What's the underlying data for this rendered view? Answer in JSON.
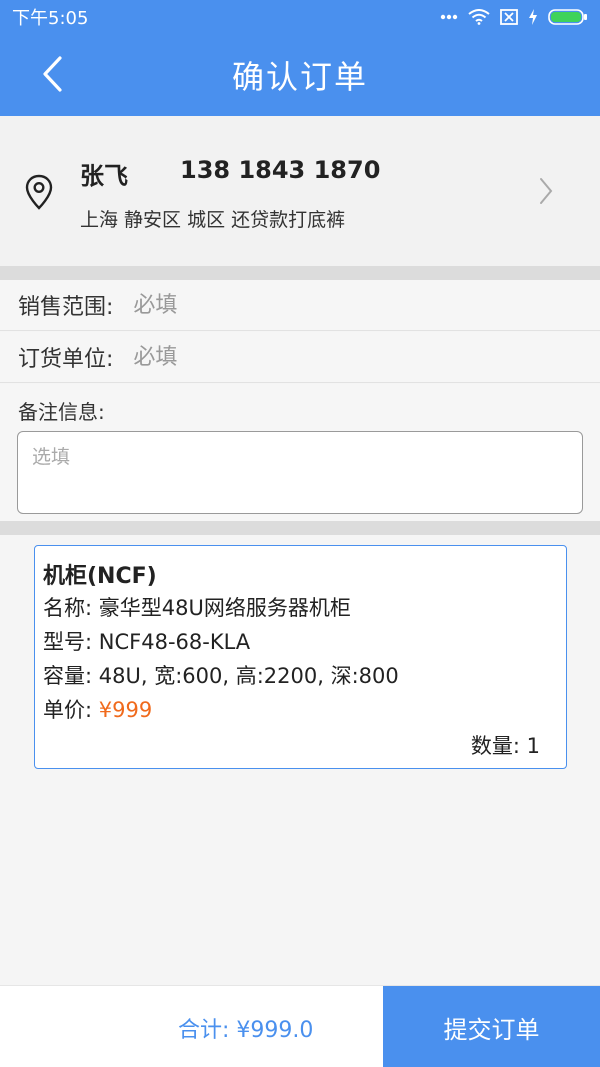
{
  "status_bar": {
    "time": "下午5:05"
  },
  "header": {
    "title": "确认订单",
    "back_icon": "chevron-left-icon"
  },
  "address": {
    "name": "张飞",
    "phone": "138 1843 1870",
    "line": "上海 静安区 城区 还贷款打底裤"
  },
  "form": {
    "sales_scope": {
      "label": "销售范围:",
      "placeholder": "必填",
      "value": ""
    },
    "order_unit": {
      "label": "订货单位:",
      "placeholder": "必填",
      "value": ""
    },
    "remark": {
      "label": "备注信息:",
      "placeholder": "选填",
      "value": ""
    }
  },
  "product": {
    "title": "机柜(NCF)",
    "name_label": "名称:",
    "name_value": "豪华型48U网络服务器机柜",
    "model_label": "型号:",
    "model_value": "NCF48-68-KLA",
    "capacity_line": "容量: 48U, 宽:600, 高:2200, 深:800",
    "price_label": "单价:",
    "price_value": "¥999",
    "qty_text": "数量: 1"
  },
  "footer": {
    "total_text": "合计: ¥999.0",
    "submit_label": "提交订单"
  },
  "colors": {
    "primary": "#4a90ee",
    "price": "#f06a1c"
  }
}
